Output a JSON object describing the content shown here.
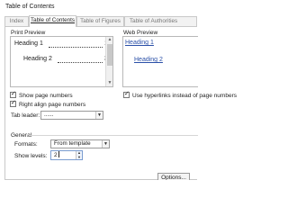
{
  "window": {
    "title": "Table of Contents"
  },
  "tabs": [
    {
      "label": "Index",
      "active": false
    },
    {
      "label": "Table of Contents",
      "active": true
    },
    {
      "label": "Table of Figures",
      "active": false
    },
    {
      "label": "Table of Authorities",
      "active": false
    }
  ],
  "print_preview": {
    "label": "Print Preview",
    "entries": [
      {
        "text": "Heading 1",
        "page": "1"
      },
      {
        "text": "Heading 2",
        "page": "3"
      }
    ]
  },
  "web_preview": {
    "label": "Web Preview",
    "links": [
      "Heading 1",
      "Heading 2"
    ]
  },
  "options": {
    "show_page_numbers": {
      "label": "Show page numbers",
      "checked": true
    },
    "right_align_page_numbers": {
      "label": "Right align page numbers",
      "checked": true
    },
    "use_hyperlinks": {
      "label": "Use hyperlinks instead of page numbers",
      "checked": true
    },
    "tab_leader": {
      "label": "Tab leader:",
      "value": "......"
    }
  },
  "general": {
    "label": "General",
    "formats": {
      "label": "Formats:",
      "value": "From template"
    },
    "show_levels": {
      "label": "Show levels:",
      "value": "2"
    }
  },
  "buttons": {
    "options": "Options..."
  },
  "icons": {
    "checkmark": "✓",
    "dropdown": "▼",
    "spin_up": "▲",
    "spin_down": "▼",
    "scroll_up": "▲",
    "scroll_down": "▼"
  },
  "colors": {
    "link": "#2b50a8",
    "focus_border": "#7a9cd0"
  }
}
